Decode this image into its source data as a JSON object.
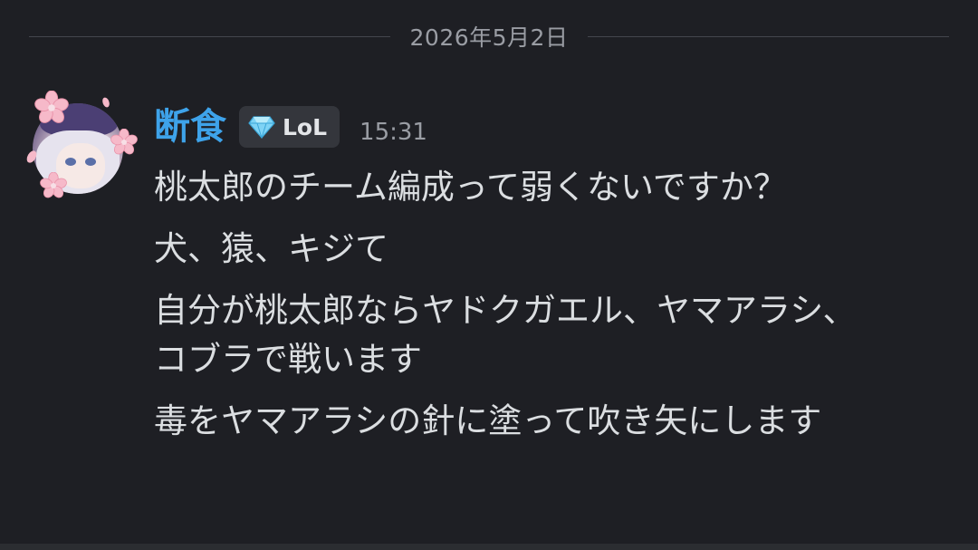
{
  "date_divider": "2026年5月2日",
  "message": {
    "username": "断食",
    "username_color": "#3ea3ea",
    "tag": {
      "icon": "diamond-icon",
      "label": "LoL"
    },
    "timestamp": "15:31",
    "avatar": "avatar-image",
    "lines": [
      "桃太郎のチーム編成って弱くないですか？",
      "犬、猿、キジて",
      "自分が桃太郎ならヤドクガエル、ヤマアラシ、コブラで戦います",
      "毒をヤマアラシの針に塗って吹き矢にします"
    ]
  }
}
